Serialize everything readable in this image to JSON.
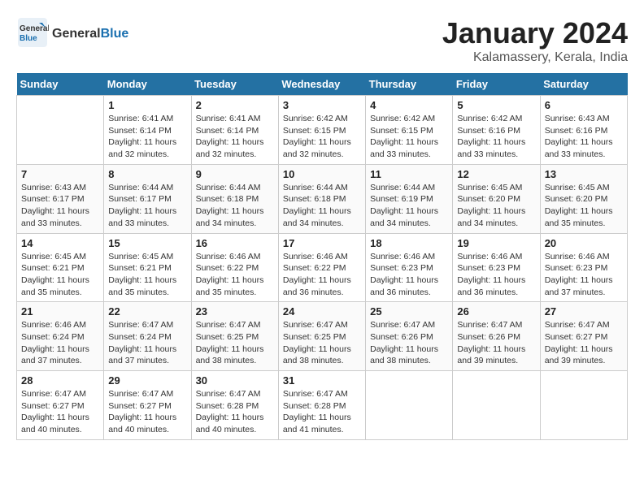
{
  "header": {
    "logo": {
      "general": "General",
      "blue": "Blue"
    },
    "title": "January 2024",
    "subtitle": "Kalamassery, Kerala, India"
  },
  "days_of_week": [
    "Sunday",
    "Monday",
    "Tuesday",
    "Wednesday",
    "Thursday",
    "Friday",
    "Saturday"
  ],
  "weeks": [
    [
      {
        "day": null
      },
      {
        "day": 1,
        "sunrise": "6:41 AM",
        "sunset": "6:14 PM",
        "daylight": "11 hours and 32 minutes."
      },
      {
        "day": 2,
        "sunrise": "6:41 AM",
        "sunset": "6:14 PM",
        "daylight": "11 hours and 32 minutes."
      },
      {
        "day": 3,
        "sunrise": "6:42 AM",
        "sunset": "6:15 PM",
        "daylight": "11 hours and 32 minutes."
      },
      {
        "day": 4,
        "sunrise": "6:42 AM",
        "sunset": "6:15 PM",
        "daylight": "11 hours and 33 minutes."
      },
      {
        "day": 5,
        "sunrise": "6:42 AM",
        "sunset": "6:16 PM",
        "daylight": "11 hours and 33 minutes."
      },
      {
        "day": 6,
        "sunrise": "6:43 AM",
        "sunset": "6:16 PM",
        "daylight": "11 hours and 33 minutes."
      }
    ],
    [
      {
        "day": 7,
        "sunrise": "6:43 AM",
        "sunset": "6:17 PM",
        "daylight": "11 hours and 33 minutes."
      },
      {
        "day": 8,
        "sunrise": "6:44 AM",
        "sunset": "6:17 PM",
        "daylight": "11 hours and 33 minutes."
      },
      {
        "day": 9,
        "sunrise": "6:44 AM",
        "sunset": "6:18 PM",
        "daylight": "11 hours and 34 minutes."
      },
      {
        "day": 10,
        "sunrise": "6:44 AM",
        "sunset": "6:18 PM",
        "daylight": "11 hours and 34 minutes."
      },
      {
        "day": 11,
        "sunrise": "6:44 AM",
        "sunset": "6:19 PM",
        "daylight": "11 hours and 34 minutes."
      },
      {
        "day": 12,
        "sunrise": "6:45 AM",
        "sunset": "6:20 PM",
        "daylight": "11 hours and 34 minutes."
      },
      {
        "day": 13,
        "sunrise": "6:45 AM",
        "sunset": "6:20 PM",
        "daylight": "11 hours and 35 minutes."
      }
    ],
    [
      {
        "day": 14,
        "sunrise": "6:45 AM",
        "sunset": "6:21 PM",
        "daylight": "11 hours and 35 minutes."
      },
      {
        "day": 15,
        "sunrise": "6:45 AM",
        "sunset": "6:21 PM",
        "daylight": "11 hours and 35 minutes."
      },
      {
        "day": 16,
        "sunrise": "6:46 AM",
        "sunset": "6:22 PM",
        "daylight": "11 hours and 35 minutes."
      },
      {
        "day": 17,
        "sunrise": "6:46 AM",
        "sunset": "6:22 PM",
        "daylight": "11 hours and 36 minutes."
      },
      {
        "day": 18,
        "sunrise": "6:46 AM",
        "sunset": "6:23 PM",
        "daylight": "11 hours and 36 minutes."
      },
      {
        "day": 19,
        "sunrise": "6:46 AM",
        "sunset": "6:23 PM",
        "daylight": "11 hours and 36 minutes."
      },
      {
        "day": 20,
        "sunrise": "6:46 AM",
        "sunset": "6:23 PM",
        "daylight": "11 hours and 37 minutes."
      }
    ],
    [
      {
        "day": 21,
        "sunrise": "6:46 AM",
        "sunset": "6:24 PM",
        "daylight": "11 hours and 37 minutes."
      },
      {
        "day": 22,
        "sunrise": "6:47 AM",
        "sunset": "6:24 PM",
        "daylight": "11 hours and 37 minutes."
      },
      {
        "day": 23,
        "sunrise": "6:47 AM",
        "sunset": "6:25 PM",
        "daylight": "11 hours and 38 minutes."
      },
      {
        "day": 24,
        "sunrise": "6:47 AM",
        "sunset": "6:25 PM",
        "daylight": "11 hours and 38 minutes."
      },
      {
        "day": 25,
        "sunrise": "6:47 AM",
        "sunset": "6:26 PM",
        "daylight": "11 hours and 38 minutes."
      },
      {
        "day": 26,
        "sunrise": "6:47 AM",
        "sunset": "6:26 PM",
        "daylight": "11 hours and 39 minutes."
      },
      {
        "day": 27,
        "sunrise": "6:47 AM",
        "sunset": "6:27 PM",
        "daylight": "11 hours and 39 minutes."
      }
    ],
    [
      {
        "day": 28,
        "sunrise": "6:47 AM",
        "sunset": "6:27 PM",
        "daylight": "11 hours and 40 minutes."
      },
      {
        "day": 29,
        "sunrise": "6:47 AM",
        "sunset": "6:27 PM",
        "daylight": "11 hours and 40 minutes."
      },
      {
        "day": 30,
        "sunrise": "6:47 AM",
        "sunset": "6:28 PM",
        "daylight": "11 hours and 40 minutes."
      },
      {
        "day": 31,
        "sunrise": "6:47 AM",
        "sunset": "6:28 PM",
        "daylight": "11 hours and 41 minutes."
      },
      {
        "day": null
      },
      {
        "day": null
      },
      {
        "day": null
      }
    ]
  ]
}
